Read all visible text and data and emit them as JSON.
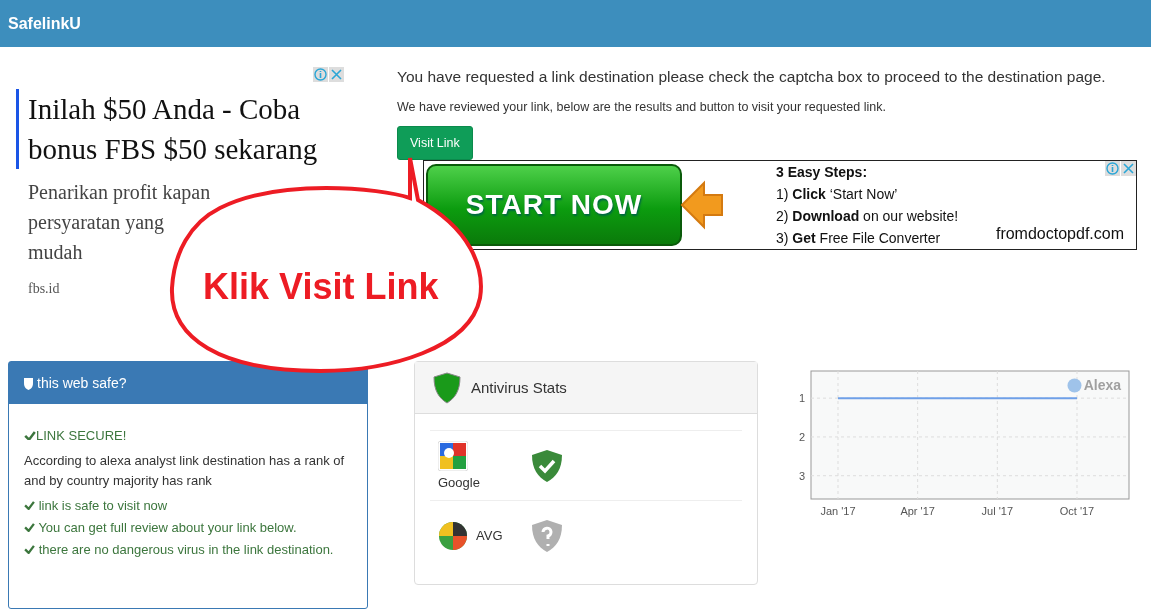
{
  "header": {
    "brand": "SafelinkU"
  },
  "side_ad": {
    "headline": "Inilah $50 Anda - Coba bonus FBS $50 sekarang",
    "description_lines": [
      "Penarikan profit kapan",
      "persyaratan yang",
      "mudah"
    ],
    "domain": "fbs.id"
  },
  "main": {
    "intro": "You have requested a link destination please check the captcha box to proceed to the destination page.",
    "note": "We have reviewed your link, below are the results and button to visit your requested link.",
    "visit_button": "Visit Link"
  },
  "banner_ad": {
    "button": "START NOW",
    "steps_title": "3 Easy Steps:",
    "steps": [
      "1) **Click** ‘Start Now’",
      "2) **Download** on our website!",
      "3) **Get** Free File Converter"
    ],
    "domain": "fromdoctopdf.com"
  },
  "annotation": {
    "text": "Klik Visit Link"
  },
  "safety_panel": {
    "title": "this web safe?",
    "status": "LINK SECURE!",
    "summary": "According to alexa analyst link destination has a rank of and by country majority has rank",
    "checks": [
      "link is safe to visit now",
      "You can get full review about your link below.",
      "there are no dangerous virus in the link destination."
    ]
  },
  "antivirus": {
    "title": "Antivirus Stats",
    "engines": [
      {
        "name": "Google",
        "kind": "stacked",
        "safe": true
      },
      {
        "name": "AVG",
        "kind": "inline",
        "safe": false
      }
    ]
  },
  "rank_chart": {
    "logo": "Alexa",
    "chart_data": {
      "type": "line",
      "ylim": [
        3.6,
        0.3
      ],
      "grid": true,
      "yticks": [
        1,
        2,
        3
      ],
      "categories": [
        "Jan '17",
        "Apr '17",
        "Jul '17",
        "Oct '17"
      ],
      "series": [
        {
          "color": "#6fa0e8",
          "values": [
            1,
            1,
            1,
            1
          ]
        }
      ]
    }
  }
}
